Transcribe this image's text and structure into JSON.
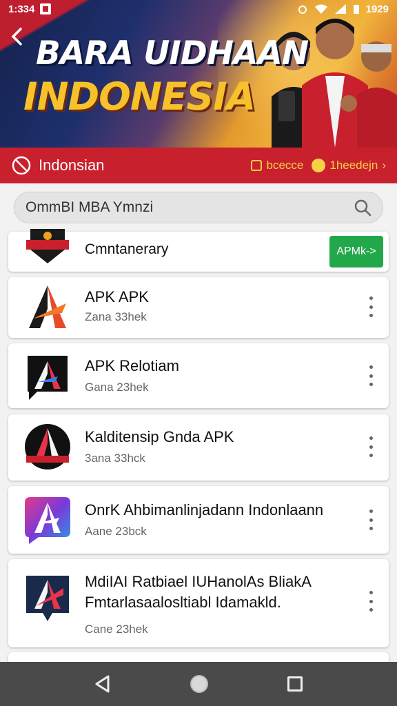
{
  "status_bar": {
    "time_left": "1:334",
    "time_right": "1929"
  },
  "banner": {
    "title_line1": "BARA UIDHAAN",
    "title_line2": "INDONESIA"
  },
  "region_bar": {
    "label": "Indonsian",
    "chip1": "bcecce",
    "chip2": "1heedejn"
  },
  "search": {
    "value": "OmmBI MBA Ymnzi"
  },
  "list": {
    "featured": {
      "name": "Cmntanerary",
      "button": "APMk->"
    },
    "items": [
      {
        "name": "APK APK",
        "sub": "Zana 33hek"
      },
      {
        "name": "APK Relotiam",
        "sub": "Gana 23hek"
      },
      {
        "name": "Kalditensip Gnda APK",
        "sub": "3ana 33hck"
      },
      {
        "name": "OnrK Ahbimanlinjadann Indonlaann",
        "sub": "Aane 23bck"
      },
      {
        "name": "MdiIAI Ratbiael IUHanolAs BliakA",
        "name2": "Fmtarlasaalosltiabl Idamakld.",
        "sub": "Cane 23hek"
      }
    ]
  },
  "colors": {
    "brand_red": "#c8202d",
    "accent_gold": "#f7d046",
    "apk_green": "#22a84a"
  }
}
